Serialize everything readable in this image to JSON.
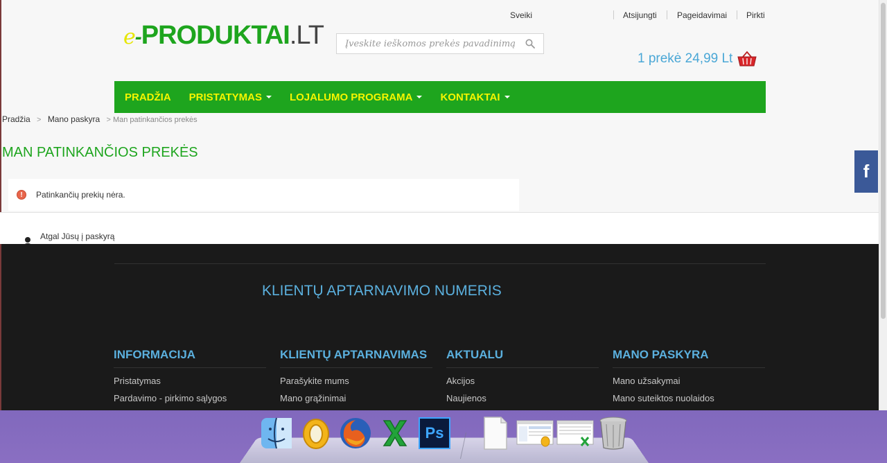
{
  "header": {
    "logo": {
      "e": "e",
      "dash": "-",
      "main": "PRODUKTAI",
      "lt": ".LT"
    },
    "top_links": {
      "greeting": "Sveiki",
      "logout": "Atsijungti",
      "wishlist": "Pageidavimai",
      "buy": "Pirkti"
    },
    "search": {
      "placeholder": "Įveskite ieškomos prekės pavadinimą",
      "value": ""
    },
    "cart": {
      "summary": "1 prekė 24,99 Lt"
    }
  },
  "nav": {
    "items": [
      {
        "label": "PRADŽIA",
        "has_dropdown": false
      },
      {
        "label": "PRISTATYMAS",
        "has_dropdown": true
      },
      {
        "label": "LOJALUMO PROGRAMA",
        "has_dropdown": true
      },
      {
        "label": "KONTAKTAI",
        "has_dropdown": true
      }
    ]
  },
  "breadcrumb": {
    "home": "Pradžia",
    "account": "Mano paskyra",
    "current": "Man patinkančios prekės",
    "separator": ">"
  },
  "main": {
    "title": "MAN PATINKANČIOS PREKĖS",
    "alert": "Patinkančių prekių nėra.",
    "back_link": "Atgal Jūsų į paskyrą"
  },
  "social": {
    "facebook": "f"
  },
  "footer": {
    "phone_title": "KLIENTŲ APTARNAVIMO NUMERIS",
    "columns": [
      {
        "title": "INFORMACIJA",
        "links": [
          "Pristatymas",
          "Pardavimo - pirkimo sąlygos"
        ]
      },
      {
        "title": "KLIENTŲ APTARNAVIMAS",
        "links": [
          "Parašykite mums",
          "Mano grąžinimai"
        ]
      },
      {
        "title": "AKTUALU",
        "links": [
          "Akcijos",
          "Naujienos"
        ]
      },
      {
        "title": "MANO PASKYRA",
        "links": [
          "Mano užsakymai",
          "Mano suteiktos nuolaidos"
        ]
      }
    ]
  },
  "colors": {
    "brand_green": "#1ea51e",
    "nav_text": "#f5f500",
    "accent_blue": "#5bb0de",
    "facebook": "#3b5998"
  },
  "dock": {
    "icons": [
      "finder-icon",
      "outlook-icon",
      "firefox-icon",
      "excel-icon",
      "photoshop-icon",
      "document-icon",
      "outlook-window-icon",
      "excel-window-icon",
      "trash-icon"
    ],
    "photoshop_label": "Ps"
  }
}
